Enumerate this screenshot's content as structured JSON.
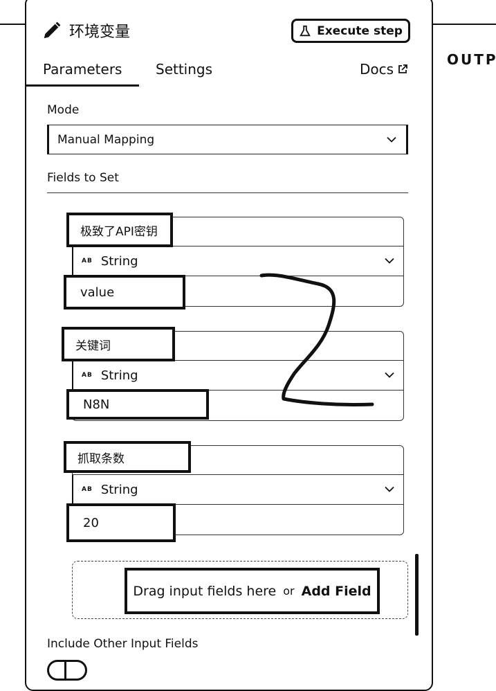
{
  "header": {
    "title": "环境变量",
    "execute_label": "Execute step",
    "output_label": "OUTP"
  },
  "tabs": {
    "parameters": "Parameters",
    "settings": "Settings",
    "docs": "Docs"
  },
  "mode": {
    "label": "Mode",
    "value": "Manual Mapping"
  },
  "fields_section": {
    "label": "Fields to Set",
    "fields": [
      {
        "name": "极致了API密钥",
        "type_badge": "AB",
        "type": "String",
        "value": "value"
      },
      {
        "name": "关键词",
        "type_badge": "AB",
        "type": "String",
        "value": "N8N"
      },
      {
        "name": "抓取条数",
        "type_badge": "AB",
        "type": "String",
        "value": "20"
      }
    ]
  },
  "dropzone": {
    "text": "Drag input fields here",
    "or": "or",
    "add_label": "Add Field"
  },
  "include_other": {
    "label": "Include Other Input Fields"
  },
  "icons": [
    "pencil-icon",
    "flask-icon",
    "external-link-icon",
    "chevron-down-icon"
  ]
}
